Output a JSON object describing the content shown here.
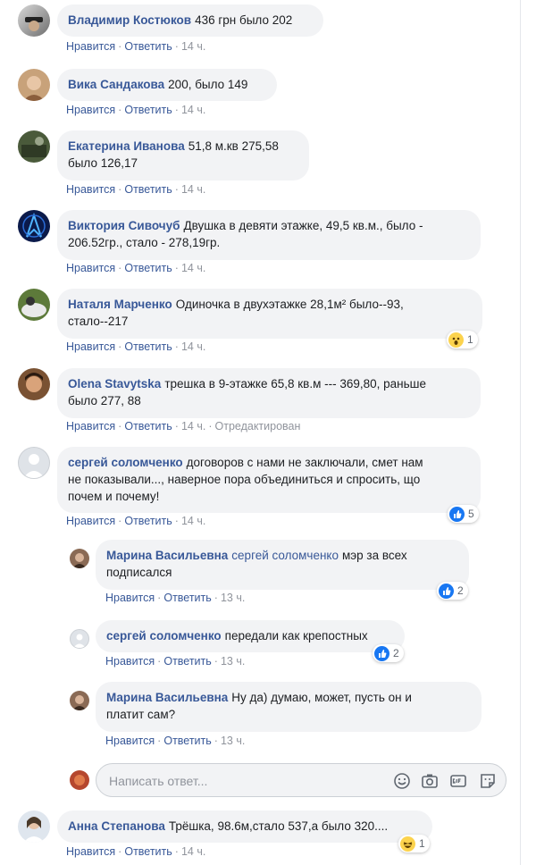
{
  "comments": [
    {
      "name": "Владимир Костюков",
      "text": "436 грн было 202",
      "like": "Нравится",
      "reply": "Ответить",
      "time": "14 ч."
    },
    {
      "name": "Вика Сандакова",
      "text": "200, было 149",
      "like": "Нравится",
      "reply": "Ответить",
      "time": "14 ч."
    },
    {
      "name": "Екатерина Иванова",
      "text_line1": "51,8 м.кв 275,58",
      "text_line2": "было 126,17",
      "like": "Нравится",
      "reply": "Ответить",
      "time": "14 ч."
    },
    {
      "name": "Виктория Сивочуб",
      "text_line1": "Двушка в девяти этажке, 49,5 кв.м., было -",
      "text_line2": "206.52гр., стало - 278,19гр.",
      "like": "Нравится",
      "reply": "Ответить",
      "time": "14 ч."
    },
    {
      "name": "Наталя Марченко",
      "text_line1": "Одиночка в двухэтажке 28,1м² было--93,",
      "text_line2": "стало--217",
      "like": "Нравится",
      "reply": "Ответить",
      "time": "14 ч.",
      "reaction": "wow",
      "reaction_count": "1"
    },
    {
      "name": "Olena Stavytska",
      "text_line1": "трешка в 9-этажке 65,8 кв.м --- 369,80, раньше",
      "text_line2": "было 277, 88",
      "like": "Нравится",
      "reply": "Ответить",
      "time": "14 ч.",
      "edited": "Отредактирован"
    },
    {
      "name": "сергей соломченко",
      "text_line1": "договоров с нами не заключали, смет нам",
      "text_line2": "не показывали..., наверное пора объединиться и спросить, що",
      "text_line3": "почем и почему!",
      "like": "Нравится",
      "reply": "Ответить",
      "time": "14 ч.",
      "reaction": "like",
      "reaction_count": "5"
    },
    {
      "name": "Анна Степанова",
      "text": "Трёшка, 98.6м,стало 537,а было 320....",
      "like": "Нравится",
      "reply": "Ответить",
      "time": "14 ч.",
      "reaction": "haha",
      "reaction_count": "1"
    }
  ],
  "replies": [
    {
      "name": "Марина Васильевна",
      "mention": "сергей соломченко",
      "text_line1": "мэр за всех",
      "text_line2": "подписался",
      "like": "Нравится",
      "reply": "Ответить",
      "time": "13 ч.",
      "reaction": "like",
      "reaction_count": "2"
    },
    {
      "name": "сергей соломченко",
      "text": "передали как крепостных",
      "like": "Нравится",
      "reply": "Ответить",
      "time": "13 ч.",
      "reaction": "like",
      "reaction_count": "2"
    },
    {
      "name": "Марина Васильевна",
      "text_line1": "Ну да) думаю, может, пусть он и",
      "text_line2": "платит сам?",
      "like": "Нравится",
      "reply": "Ответить",
      "time": "13 ч."
    }
  ],
  "reply_box": {
    "placeholder": "Написать ответ..."
  },
  "separator": "·",
  "colors": {
    "link": "#385898",
    "bubble": "#f2f3f5",
    "like_blue": "#1877f2",
    "emoji_yellow": "#fcd34d"
  }
}
